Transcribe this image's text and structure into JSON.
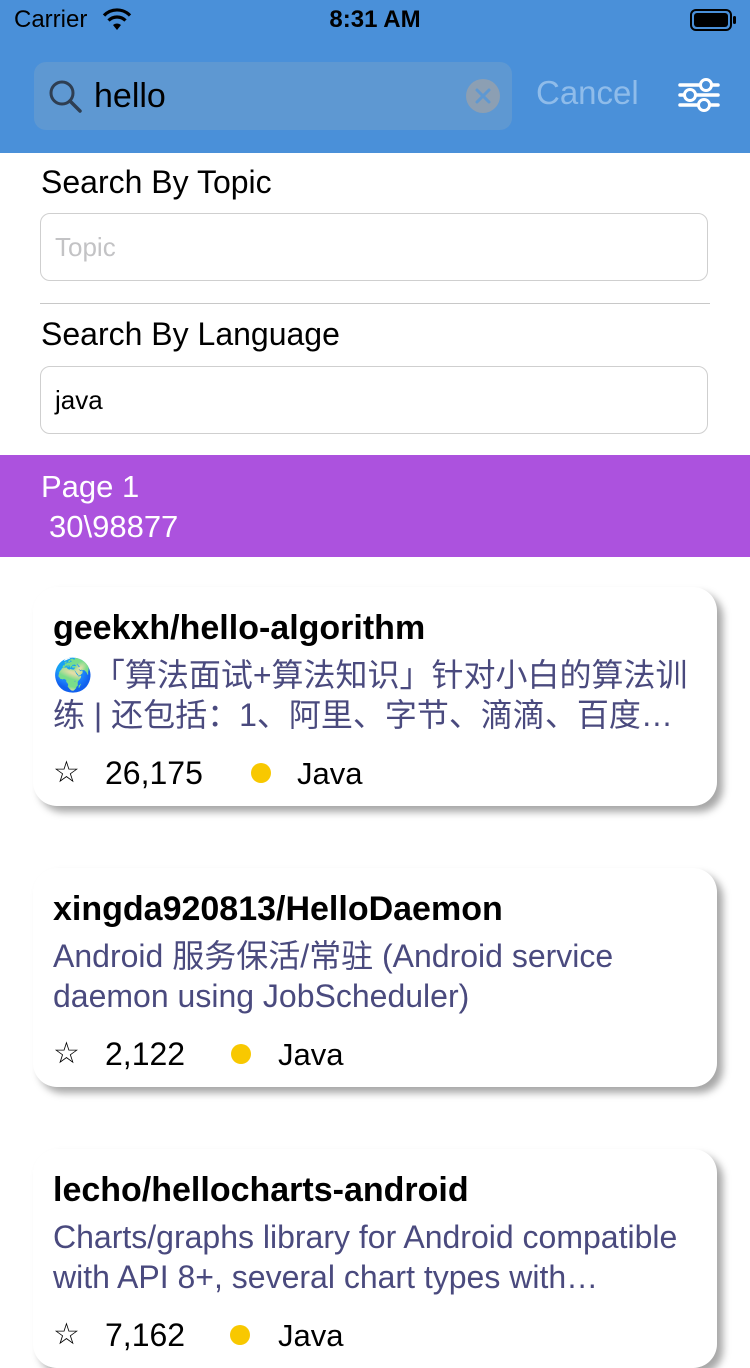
{
  "status": {
    "carrier": "Carrier",
    "time": "8:31 AM"
  },
  "search": {
    "query": "hello",
    "cancel_label": "Cancel"
  },
  "filters": {
    "topic_label": "Search By Topic",
    "topic_placeholder": "Topic",
    "topic_value": "",
    "language_label": "Search By Language",
    "language_value": "java"
  },
  "page": {
    "title": "Page 1",
    "count": "30\\98877"
  },
  "colors": {
    "header": "#4a90d9",
    "banner": "#ac52de",
    "lang_dot": "#f8c800",
    "desc_text": "#4a4a7e"
  },
  "repos": [
    {
      "name": "geekxh/hello-algorithm",
      "description": "🌍「算法面试+算法知识」针对小白的算法训练 | 还包括：1、阿里、字节、滴滴、百度…",
      "stars": "26,175",
      "language": "Java"
    },
    {
      "name": "xingda920813/HelloDaemon",
      "description": "Android 服务保活/常驻 (Android service daemon using JobScheduler)",
      "stars": "2,122",
      "language": "Java"
    },
    {
      "name": "lecho/hellocharts-android",
      "description": "Charts/graphs library for Android compatible with API 8+, several chart types with…",
      "stars": "7,162",
      "language": "Java"
    }
  ]
}
